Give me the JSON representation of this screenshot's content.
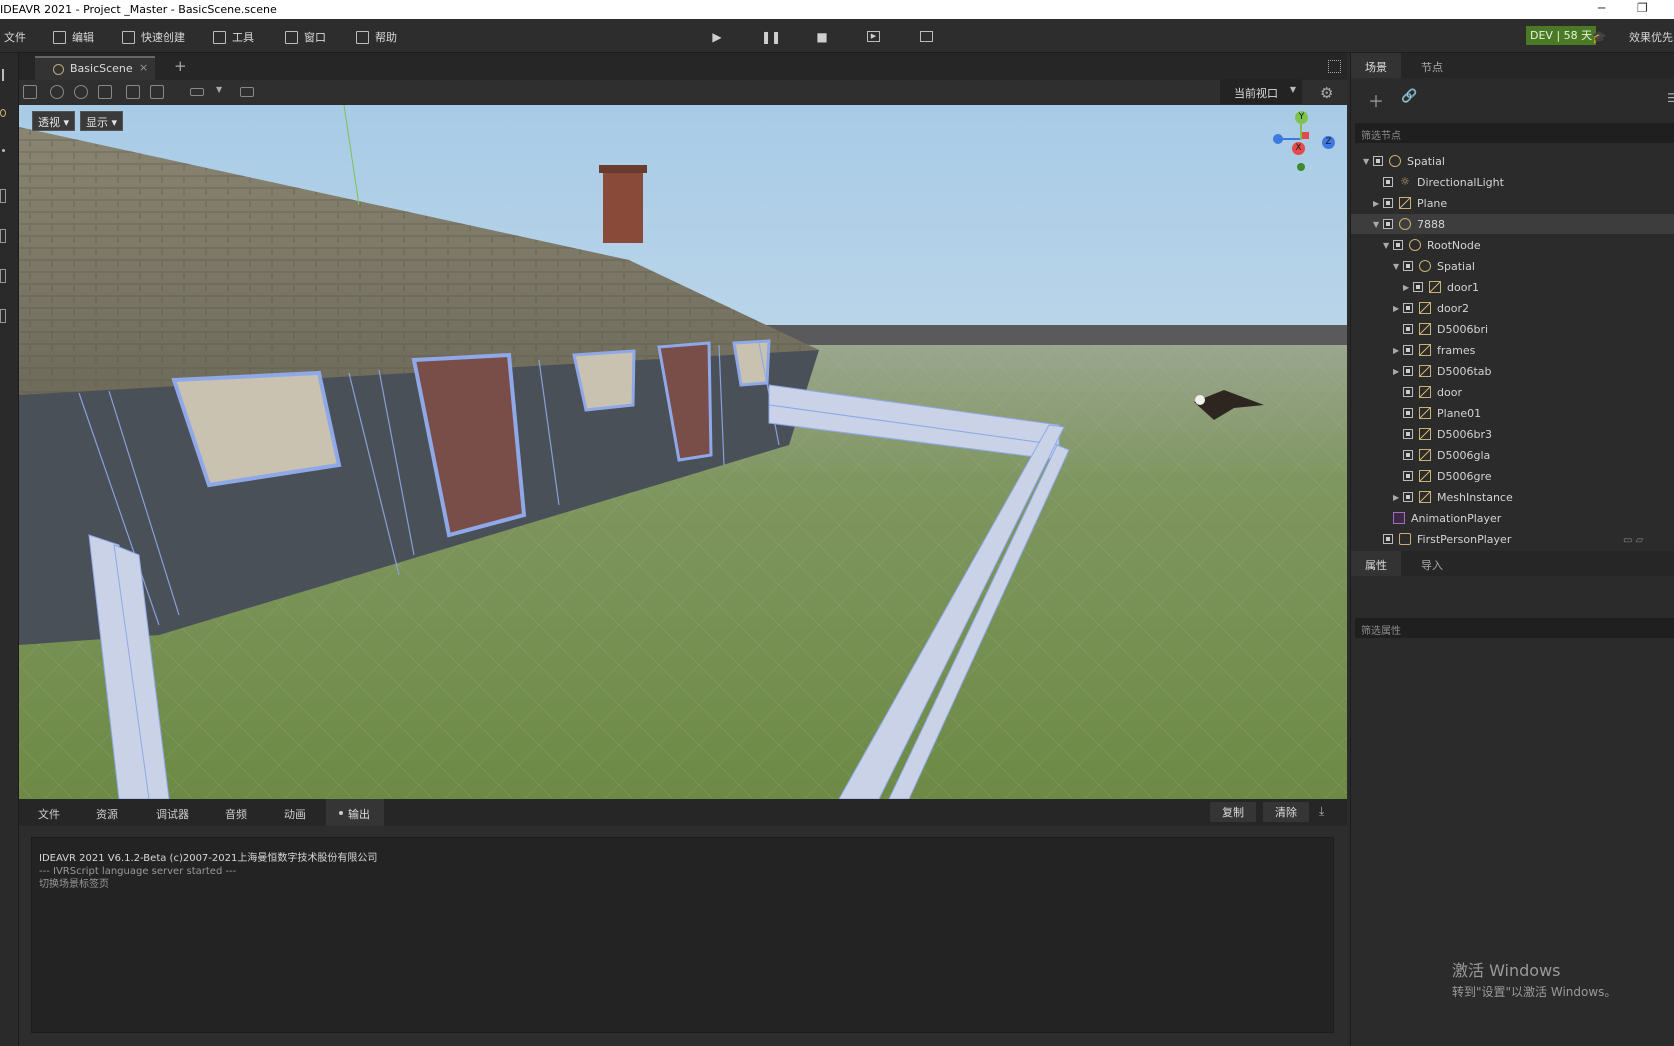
{
  "window": {
    "title": "IDEAVR 2021 - Project _Master - BasicScene.scene",
    "minimize": "─",
    "restore": "❐"
  },
  "menu": {
    "file": "文件",
    "edit": "编辑",
    "quick_create": "快速创建",
    "tools": "工具",
    "window": "窗口",
    "help": "帮助",
    "dev_badge": "DEV | 58 天",
    "effect": "效果优先"
  },
  "editor": {
    "scene_tab": "BasicScene",
    "close": "×",
    "add_tab": "+",
    "view_select": "当前视口",
    "perspective_btn": "透视",
    "display_btn": "显示"
  },
  "gizmo": {
    "y": "Y",
    "x": "X",
    "z": "Z"
  },
  "bottom": {
    "tabs": [
      "文件",
      "资源",
      "调试器",
      "音频",
      "动画"
    ],
    "active_tab": "输出",
    "copy": "复制",
    "clear": "清除",
    "output_lines": [
      "IDEAVR 2021 V6.1.2-Beta (c)2007-2021上海曼恒数字技术股份有限公司",
      "--- IVRScript language server started ---",
      "切换场景标签页"
    ]
  },
  "scene_dock": {
    "tab_scene": "场景",
    "tab_node": "节点",
    "filter_placeholder": "筛选节点",
    "tree": [
      {
        "label": "Spatial",
        "icon": "spatial",
        "depth": 0,
        "arrow": "▼"
      },
      {
        "label": "DirectionalLight",
        "icon": "light",
        "depth": 1,
        "arrow": ""
      },
      {
        "label": "Plane",
        "icon": "mesh",
        "depth": 1,
        "arrow": "▶"
      },
      {
        "label": "7888",
        "icon": "spatial",
        "depth": 1,
        "arrow": "▼",
        "selected": true
      },
      {
        "label": "RootNode",
        "icon": "spatial",
        "depth": 2,
        "arrow": "▼"
      },
      {
        "label": "Spatial",
        "icon": "spatial",
        "depth": 3,
        "arrow": "▼"
      },
      {
        "label": "door1",
        "icon": "mesh",
        "depth": 4,
        "arrow": "▶"
      },
      {
        "label": "door2",
        "icon": "mesh",
        "depth": 3,
        "arrow": "▶"
      },
      {
        "label": "D5006bri",
        "icon": "mesh",
        "depth": 3,
        "arrow": ""
      },
      {
        "label": "frames",
        "icon": "mesh",
        "depth": 3,
        "arrow": "▶"
      },
      {
        "label": "D5006tab",
        "icon": "mesh",
        "depth": 3,
        "arrow": "▶"
      },
      {
        "label": "door",
        "icon": "mesh",
        "depth": 3,
        "arrow": ""
      },
      {
        "label": "Plane01",
        "icon": "mesh",
        "depth": 3,
        "arrow": ""
      },
      {
        "label": "D5006br3",
        "icon": "mesh",
        "depth": 3,
        "arrow": ""
      },
      {
        "label": "D5006gla",
        "icon": "mesh",
        "depth": 3,
        "arrow": ""
      },
      {
        "label": "D5006gre",
        "icon": "mesh",
        "depth": 3,
        "arrow": ""
      },
      {
        "label": "MeshInstance",
        "icon": "mesh",
        "depth": 3,
        "arrow": "▶"
      },
      {
        "label": "AnimationPlayer",
        "icon": "anim",
        "depth": 2,
        "arrow": "",
        "nocheck": true
      },
      {
        "label": "FirstPersonPlayer",
        "icon": "player",
        "depth": 1,
        "arrow": ""
      }
    ]
  },
  "inspector_dock": {
    "tab_properties": "属性",
    "tab_import": "导入",
    "filter_placeholder": "筛选属性"
  },
  "watermark": {
    "line1": "激活 Windows",
    "line2": "转到\"设置\"以激活 Windows。"
  },
  "colors": {
    "accent_green": "#4b7a27",
    "node_icon": "#c8b172",
    "selection_wire": "#8fa8e8"
  }
}
